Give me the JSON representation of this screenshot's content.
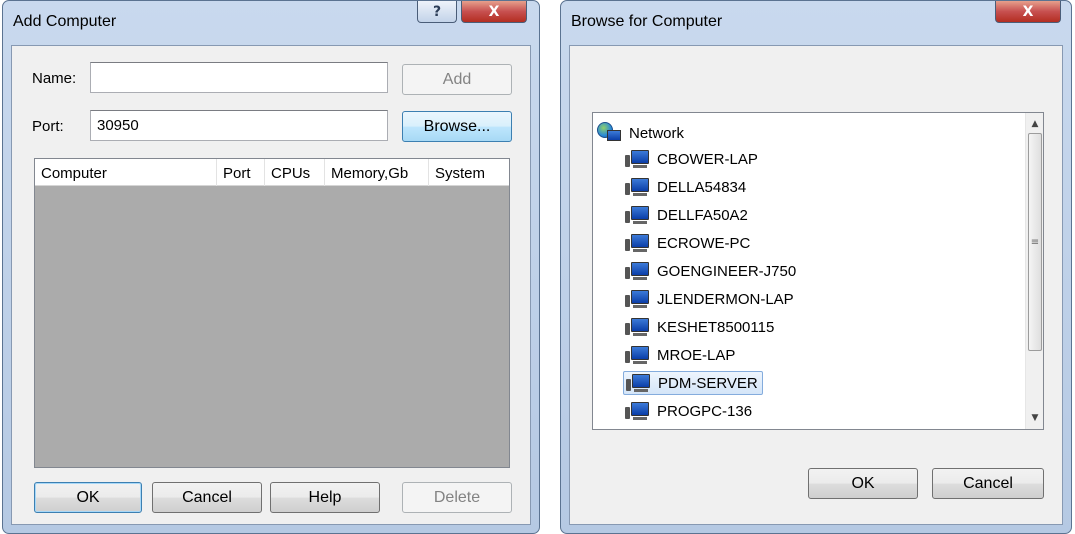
{
  "add_computer": {
    "title": "Add Computer",
    "help_glyph": "?",
    "close_glyph": "X",
    "name_label": "Name:",
    "name_value": "",
    "port_label": "Port:",
    "port_value": "30950",
    "add_label": "Add",
    "browse_label": "Browse...",
    "columns": [
      "Computer",
      "Port",
      "CPUs",
      "Memory,Gb",
      "System"
    ],
    "ok_label": "OK",
    "cancel_label": "Cancel",
    "help_label": "Help",
    "delete_label": "Delete"
  },
  "browse": {
    "title": "Browse for Computer",
    "close_glyph": "X",
    "root_label": "Network",
    "items": [
      "CBOWER-LAP",
      "DELLA54834",
      "DELLFA50A2",
      "ECROWE-PC",
      "GOENGINEER-J750",
      "JLENDERMON-LAP",
      "KESHET8500115",
      "MROE-LAP",
      "PDM-SERVER",
      "PROGPC-136"
    ],
    "selected": "PDM-SERVER",
    "scroll_up": "▲",
    "scroll_down": "▼",
    "thumb_grip": "≡",
    "ok_label": "OK",
    "cancel_label": "Cancel"
  }
}
